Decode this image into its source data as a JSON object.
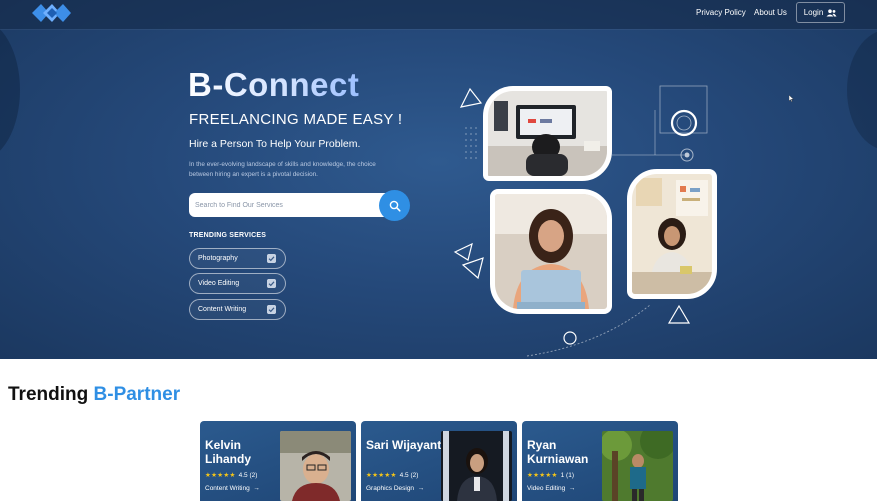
{
  "nav": {
    "links": [
      "Privacy Policy",
      "About Us"
    ],
    "login_label": "Login"
  },
  "hero": {
    "title": "B-Connect",
    "tagline": "FREELANCING MADE EASY !",
    "subtagline": "Hire a Person To Help Your Problem.",
    "description": "In the ever-evolving landscape of skills and knowledge, the choice between hiring an expert is a pivotal decision.",
    "search_placeholder": "Search to Find Our Services",
    "trending_label": "TRENDING SERVICES",
    "trending_services": [
      "Photography",
      "Video Editing",
      "Content Writing"
    ]
  },
  "partners": {
    "title_prefix": "Trending",
    "title_accent": "B-Partner",
    "cards": [
      {
        "name": "Kelvin Lihandy",
        "stars": "★★★★★",
        "rating": "4.5 (2)",
        "service": "Content Writing"
      },
      {
        "name": "Sari Wijayanti",
        "stars": "★★★★★",
        "rating": "4.5 (2)",
        "service": "Graphics Design"
      },
      {
        "name": "Ryan Kurniawan",
        "stars": "★★★★★",
        "rating": "1 (1)",
        "service": "Video Editing"
      }
    ]
  },
  "colors": {
    "accent": "#2f8fe4",
    "hero_bg": "#25497a",
    "card_bg": "#234e80",
    "star": "#f5c518"
  },
  "icons": {
    "logo": "diamond-chain-logo",
    "login": "users-icon",
    "search": "search-icon",
    "checkbox": "check-icon",
    "arrow": "arrow-right-icon"
  }
}
